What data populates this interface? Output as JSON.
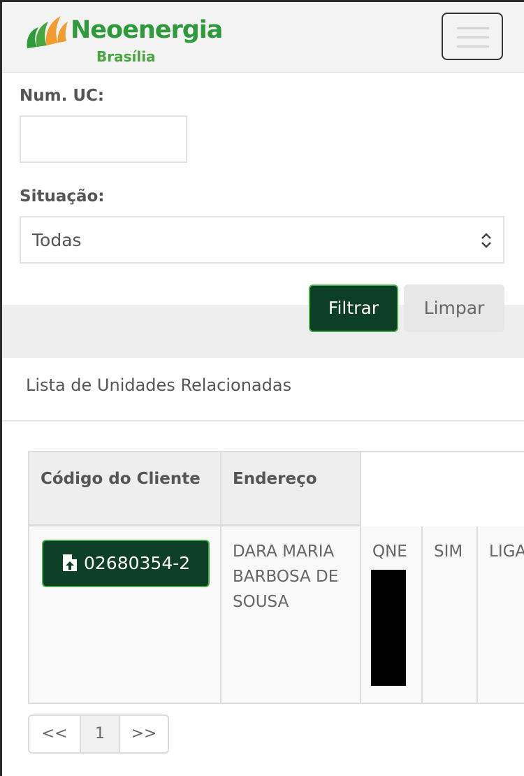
{
  "header": {
    "brand_name": "Neoenergia",
    "brand_sub": "Brasília",
    "colors": {
      "brand_green": "#2e9a3b",
      "orange": "#f39b2e",
      "dark_green": "#0d3f27"
    }
  },
  "filters": {
    "uc_label": "Num. UC:",
    "uc_value": "",
    "status_label": "Situação:",
    "status_selected": "Todas",
    "filter_button": "Filtrar",
    "clear_button": "Limpar"
  },
  "list": {
    "title": "Lista de Unidades Relacionadas",
    "columns": [
      "Código do Cliente",
      "Endereço"
    ],
    "rows": [
      {
        "client_code": "02680354-2",
        "address": "DARA MARIA BARBOSA DE SOUSA",
        "col3": "QNE",
        "col4": "SIM",
        "col5": "LIGA"
      }
    ]
  },
  "pagination": {
    "prev": "<<",
    "current": "1",
    "next": ">>"
  }
}
